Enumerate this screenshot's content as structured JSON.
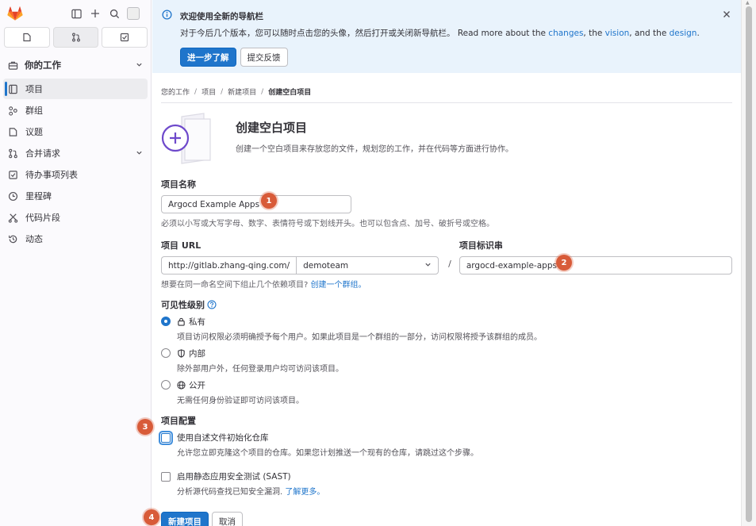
{
  "sidebar": {
    "section_title": "你的工作",
    "items": [
      {
        "label": "项目",
        "icon": "project-icon"
      },
      {
        "label": "群组",
        "icon": "group-icon"
      },
      {
        "label": "议题",
        "icon": "issues-icon"
      },
      {
        "label": "合并请求",
        "icon": "merge-request-icon"
      },
      {
        "label": "待办事项列表",
        "icon": "todo-icon"
      },
      {
        "label": "里程碑",
        "icon": "milestone-icon"
      },
      {
        "label": "代码片段",
        "icon": "snippet-icon"
      },
      {
        "label": "动态",
        "icon": "activity-icon"
      }
    ]
  },
  "banner": {
    "title": "欢迎使用全新的导航栏",
    "text_before": "对于今后几个版本，您可以随时点击您的头像，然后打开或关闭新导航栏。 Read more about the ",
    "link1": "changes",
    "text_mid1": ", the ",
    "link2": "vision",
    "text_mid2": ", and the ",
    "link3": "design",
    "text_end": ".",
    "btn_learn": "进一步了解",
    "btn_feedback": "提交反馈"
  },
  "breadcrumb": [
    "您的工作",
    "项目",
    "新建项目",
    "创建空白项目"
  ],
  "header": {
    "title": "创建空白项目",
    "desc": "创建一个空白项目来存放您的文件，规划您的工作，并在代码等方面进行协作。"
  },
  "form": {
    "name_label": "项目名称",
    "name_value": "Argocd Example Apps",
    "name_help": "必须以小写或大写字母、数字、表情符号或下划线开头。也可以包含点、加号、破折号或空格。",
    "url_label": "项目 URL",
    "url_prefix": "http://gitlab.zhang-qing.com/",
    "namespace": "demoteam",
    "slug_label": "项目标识串",
    "slug_value": "argocd-example-apps",
    "group_help": "想要在同一命名空间下组止几个依赖项目?",
    "group_link": "创建一个群组。",
    "visibility_label": "可见性级别",
    "visibility": [
      {
        "title": "私有",
        "desc": "项目访问权限必须明确授予每个用户。如果此项目是一个群组的一部分，访问权限将授予该群组的成员。",
        "checked": true
      },
      {
        "title": "内部",
        "desc": "除外部用户外，任何登录用户均可访问该项目。",
        "checked": false
      },
      {
        "title": "公开",
        "desc": "无需任何身份验证即可访问该项目。",
        "checked": false
      }
    ],
    "config_label": "项目配置",
    "readme_title": "使用自述文件初始化仓库",
    "readme_desc": "允许您立即克隆这个项目的仓库。如果您计划推送一个现有的仓库，请跳过这个步骤。",
    "sast_title": "启用静态应用安全测试 (SAST)",
    "sast_desc": "分析源代码查找已知安全漏洞.",
    "sast_link": "了解更多。",
    "submit": "新建项目",
    "cancel": "取消"
  },
  "markers": [
    "1",
    "2",
    "3",
    "4"
  ],
  "colors": {
    "accent": "#1f75cb",
    "marker": "#d85b39",
    "banner": "#e9f3fc"
  }
}
